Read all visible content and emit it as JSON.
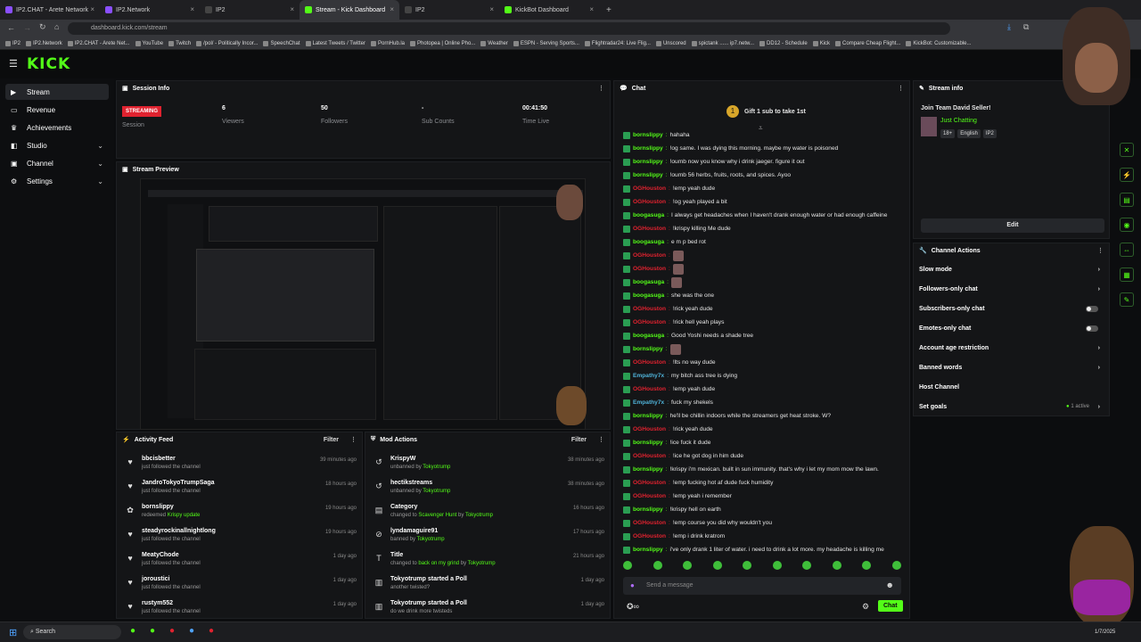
{
  "colors": {
    "accent": "#53fc18",
    "live": "#e0222f",
    "mod_name": "#e0222f"
  },
  "browser": {
    "tabs": [
      {
        "label": "IP2.CHAT - Arete Network",
        "color": "#8a4fff"
      },
      {
        "label": "IP2.Network",
        "color": "#8a4fff"
      },
      {
        "label": "IP2",
        "color": "#444"
      },
      {
        "label": "Stream - Kick Dashboard",
        "color": "#53fc18",
        "active": true
      },
      {
        "label": "IP2",
        "color": "#444"
      },
      {
        "label": "KickBot Dashboard",
        "color": "#53fc18"
      }
    ],
    "url": "dashboard.kick.com/stream",
    "bookmarks": [
      "IP2",
      "IP2.Network",
      "IP2.CHAT - Arete Net...",
      "YouTube",
      "Twitch",
      "/pol/ - Politically Incor...",
      "SpeechChat",
      "Latest Tweets / Twitter",
      "PornHub.la",
      "Photopea | Online Pho...",
      "Weather",
      "ESPN - Serving Sports...",
      "Flightradar24: Live Flig...",
      "Unscored",
      "spictank ...... ip7.netw...",
      "DD12 - Schedule",
      "Kick",
      "Compare Cheap Flight...",
      "KickBot: Customizable..."
    ]
  },
  "brand": {
    "logo": "KICK"
  },
  "sidebar": {
    "items": [
      {
        "label": "Stream",
        "icon": "stream-icon",
        "active": true
      },
      {
        "label": "Revenue",
        "icon": "revenue-icon"
      },
      {
        "label": "Achievements",
        "icon": "trophy-icon"
      },
      {
        "label": "Studio",
        "icon": "studio-icon",
        "chevron": true
      },
      {
        "label": "Channel",
        "icon": "channel-icon",
        "chevron": true
      },
      {
        "label": "Settings",
        "icon": "gear-icon",
        "chevron": true
      }
    ]
  },
  "session": {
    "title": "Session Info",
    "status": "STREAMING",
    "status_label": "Session",
    "stats": [
      {
        "value": "6",
        "label": "Viewers"
      },
      {
        "value": "50",
        "label": "Followers"
      },
      {
        "value": "-",
        "label": "Sub Counts"
      },
      {
        "value": "00:41:50",
        "label": "Time Live"
      }
    ]
  },
  "preview": {
    "title": "Stream Preview"
  },
  "activity": {
    "title": "Activity Feed",
    "filter": "Filter",
    "items": [
      {
        "icon": "heart-icon",
        "name": "bbcisbetter",
        "sub": "just followed the channel",
        "time": "39 minutes ago"
      },
      {
        "icon": "heart-icon",
        "name": "JandroTokyoTrumpSaga",
        "sub": "just followed the channel",
        "time": "18 hours ago"
      },
      {
        "icon": "redeem-icon",
        "name": "bornslippy",
        "sub": "redeemed ",
        "hl": "Krispy update",
        "time": "19 hours ago"
      },
      {
        "icon": "heart-icon",
        "name": "steadyrockinallnightlong",
        "sub": "just followed the channel",
        "time": "19 hours ago"
      },
      {
        "icon": "heart-icon",
        "name": "MeatyChode",
        "sub": "just followed the channel",
        "time": "1 day ago"
      },
      {
        "icon": "heart-icon",
        "name": "joroustici",
        "sub": "just followed the channel",
        "time": "1 day ago"
      },
      {
        "icon": "heart-icon",
        "name": "rustym552",
        "sub": "just followed the channel",
        "time": "1 day ago"
      }
    ]
  },
  "modactions": {
    "title": "Mod Actions",
    "filter": "Filter",
    "items": [
      {
        "icon": "undo-icon",
        "name": "KrispyW",
        "sub": "unbanned by ",
        "hl": "Tokyotrump",
        "time": "38 minutes ago"
      },
      {
        "icon": "undo-icon",
        "name": "hectikstreams",
        "sub": "unbanned by ",
        "hl": "Tokyotrump",
        "time": "38 minutes ago"
      },
      {
        "icon": "category-icon",
        "name": "Category",
        "sub": "changed to ",
        "hl": "Scavenger Hunt",
        "sub2": " by ",
        "hl2": "Tokyotrump",
        "time": "16 hours ago"
      },
      {
        "icon": "ban-icon",
        "name": "lyndamaguire91",
        "sub": "banned by ",
        "hl": "Tokyotrump",
        "time": "17 hours ago"
      },
      {
        "icon": "title-icon",
        "name": "Title",
        "sub": "changed to ",
        "hl": "back on my grind",
        "sub2": " by ",
        "hl2": "Tokyotrump",
        "time": "21 hours ago"
      },
      {
        "icon": "poll-icon",
        "name": "Tokyotrump started a Poll",
        "sub": "another twisted?",
        "time": "1 day ago"
      },
      {
        "icon": "poll-icon",
        "name": "Tokyotrump started a Poll",
        "sub": "do we drink more twisteds",
        "time": "1 day ago"
      }
    ]
  },
  "chat": {
    "title": "Chat",
    "gift": "Gift 1 sub to take 1st",
    "placeholder": "Send a message",
    "send": "Chat",
    "messages": [
      {
        "user": "bornslippy",
        "color": "#53fc18",
        "text": "hahaha"
      },
      {
        "user": "bornslippy",
        "color": "#53fc18",
        "text": "!og same. I was dying this morning. maybe my water is poisoned"
      },
      {
        "user": "bornslippy",
        "color": "#53fc18",
        "text": "!oumb now you know why i drink jaeger. figure it out"
      },
      {
        "user": "bornslippy",
        "color": "#53fc18",
        "text": "!oumb 56 herbs, fruits, roots, and spices. Ayoo"
      },
      {
        "user": "OGHouston",
        "color": "#e0222f",
        "text": "!emp yeah dude"
      },
      {
        "user": "OGHouston",
        "color": "#e0222f",
        "text": "!og yeah played a bit"
      },
      {
        "user": "boogasuga",
        "color": "#53fc18",
        "text": "I always get headaches when I haven't drank enough water or had enough caffeine"
      },
      {
        "user": "OGHouston",
        "color": "#e0222f",
        "text": "!krispy killing Me dude"
      },
      {
        "user": "boogasuga",
        "color": "#53fc18",
        "text": "e m p bed rot"
      },
      {
        "user": "OGHouston",
        "color": "#e0222f",
        "text": ""
      },
      {
        "user": "OGHouston",
        "color": "#e0222f",
        "text": ""
      },
      {
        "user": "boogasuga",
        "color": "#53fc18",
        "text": ""
      },
      {
        "user": "boogasuga",
        "color": "#53fc18",
        "text": "she was the one"
      },
      {
        "user": "OGHouston",
        "color": "#e0222f",
        "text": "!rick yeah dude"
      },
      {
        "user": "OGHouston",
        "color": "#e0222f",
        "text": "!rick hell yeah plays"
      },
      {
        "user": "boogasuga",
        "color": "#53fc18",
        "text": "Good Yoshi needs a shade tree"
      },
      {
        "user": "bornslippy",
        "color": "#53fc18",
        "text": ""
      },
      {
        "user": "OGHouston",
        "color": "#e0222f",
        "text": "!lts no way dude"
      },
      {
        "user": "Empathy7x",
        "color": "#4fb3d9",
        "text": "my bitch ass tree is dying"
      },
      {
        "user": "OGHouston",
        "color": "#e0222f",
        "text": "!emp yeah dude"
      },
      {
        "user": "Empathy7x",
        "color": "#4fb3d9",
        "text": "fuck my shekels"
      },
      {
        "user": "bornslippy",
        "color": "#53fc18",
        "text": "he'll be chillin indoors while the streamers get heat stroke. W?"
      },
      {
        "user": "OGHouston",
        "color": "#e0222f",
        "text": "!rick yeah dude"
      },
      {
        "user": "bornslippy",
        "color": "#53fc18",
        "text": "!ice fuck it dude"
      },
      {
        "user": "OGHouston",
        "color": "#e0222f",
        "text": "!ice he got dog in him dude"
      },
      {
        "user": "bornslippy",
        "color": "#53fc18",
        "text": "!krispy i'm mexican. built in sun immunity. that's why i let my mom mow the lawn."
      },
      {
        "user": "OGHouston",
        "color": "#e0222f",
        "text": "!emp fucking hot af dude fuck humidity"
      },
      {
        "user": "OGHouston",
        "color": "#e0222f",
        "text": "!emp yeah i remember"
      },
      {
        "user": "bornslippy",
        "color": "#53fc18",
        "text": "!krispy hell on earth"
      },
      {
        "user": "OGHouston",
        "color": "#e0222f",
        "text": "!emp course you did why wouldn't you"
      },
      {
        "user": "OGHouston",
        "color": "#e0222f",
        "text": "!emp i drink kratrom"
      },
      {
        "user": "bornslippy",
        "color": "#53fc18",
        "text": "i've only drank 1 liter of water. i need to drink a lot more. my headache is killing me"
      }
    ]
  },
  "streaminfo": {
    "title": "Stream info",
    "stream_title": "Join Team David Seller!",
    "category": "Just Chatting",
    "tags": [
      "18+",
      "English",
      "IP2"
    ],
    "edit": "Edit"
  },
  "channel_actions": {
    "title": "Channel Actions",
    "rows": [
      {
        "label": "Slow mode",
        "kind": "arrow"
      },
      {
        "label": "Followers-only chat",
        "kind": "arrow"
      },
      {
        "label": "Subscribers-only chat",
        "kind": "toggle"
      },
      {
        "label": "Emotes-only chat",
        "kind": "toggle"
      },
      {
        "label": "Account age restriction",
        "kind": "arrow"
      },
      {
        "label": "Banned words",
        "kind": "arrow"
      },
      {
        "label": "Host Channel",
        "kind": "none"
      },
      {
        "label": "Set goals",
        "kind": "arrow",
        "extra": "1 active"
      }
    ]
  },
  "taskbar": {
    "search": "Search",
    "date": "1/7/2025"
  }
}
